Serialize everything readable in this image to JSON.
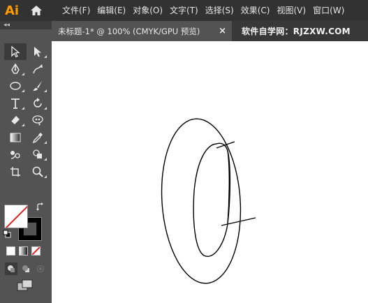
{
  "app": {
    "logo": "Ai"
  },
  "menu": [
    "文件(F)",
    "编辑(E)",
    "对象(O)",
    "文字(T)",
    "选择(S)",
    "效果(C)",
    "视图(V)",
    "窗口(W)"
  ],
  "tab": {
    "label": "未标题-1* @ 100% (CMYK/GPU 预览)",
    "close": "×"
  },
  "watermark": "软件自学网：RJZXW.COM",
  "toolbar": {
    "collapse": "◂◂",
    "more": "•••",
    "tools": [
      [
        "selection-tool",
        "direct-selection-tool"
      ],
      [
        "pen-tool",
        "curvature-tool"
      ],
      [
        "ellipse-tool",
        "paintbrush-tool"
      ],
      [
        "type-tool",
        "rotate-tool"
      ],
      [
        "eraser-tool",
        "puppet-warp-tool"
      ],
      [
        "gradient-tool",
        "eyedropper-tool"
      ],
      [
        "blend-tool",
        "shape-builder-tool"
      ],
      [
        "artboard-tool",
        "zoom-tool"
      ]
    ]
  },
  "colors": {
    "menubar": "#323232",
    "panel": "#535353",
    "logo": "#ff9a00",
    "none_slash": "#e02020"
  }
}
